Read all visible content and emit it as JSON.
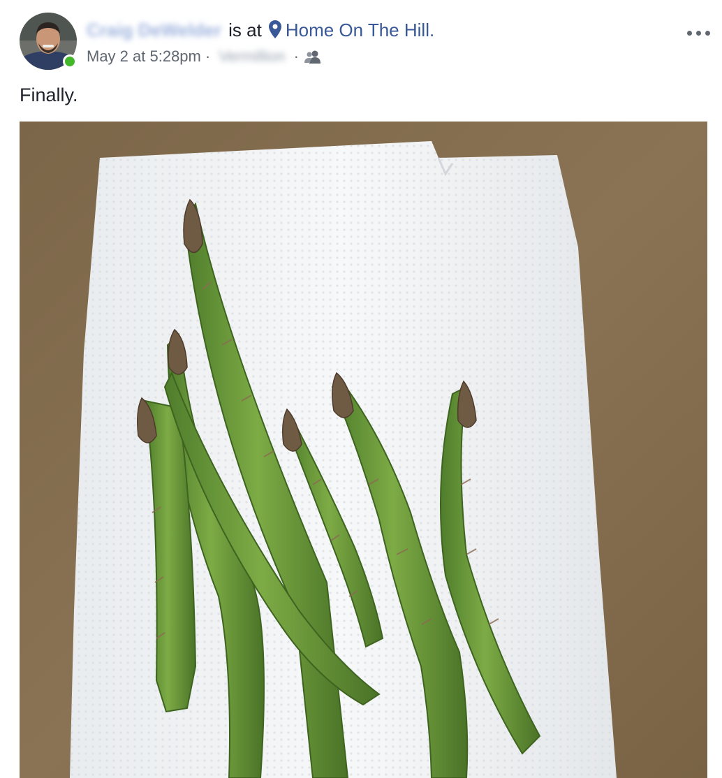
{
  "post": {
    "author_name": "Craig DeWelder",
    "is_at": "is at",
    "place": "Home On The Hill",
    "period": ".",
    "timestamp": "May 2 at 5:28pm",
    "location": "Vermillion",
    "separator": "·",
    "text": "Finally.",
    "icons": {
      "more": "more-options-icon",
      "pin": "location-pin-icon",
      "audience": "friends-audience-icon"
    },
    "colors": {
      "link": "#385898",
      "online": "#42b72a",
      "meta": "#606770"
    }
  }
}
